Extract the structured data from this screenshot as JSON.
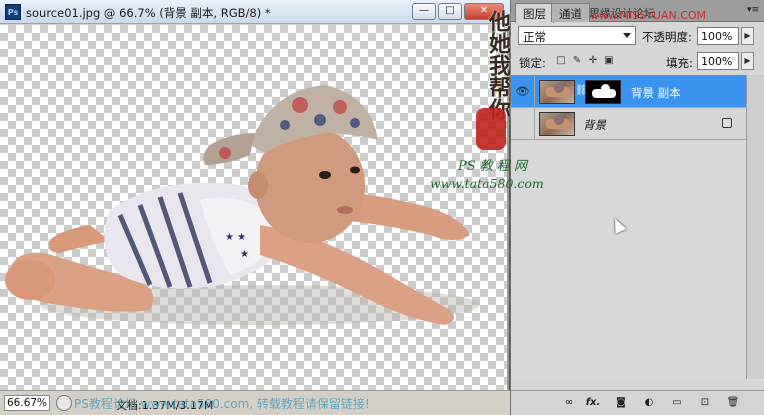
{
  "document": {
    "app_logo": "Ps",
    "title": "source01.jpg @ 66.7% (背景 副本, RGB/8) *",
    "window_buttons": {
      "minimize": "—",
      "maximize": "□",
      "close": "✕"
    },
    "zoom": "66.67%",
    "doc_info": "文档:1.37M/3.17M"
  },
  "panel": {
    "tabs": [
      {
        "label": "图层",
        "active": true
      },
      {
        "label": "通道",
        "active": false
      }
    ],
    "tab_overflow_text": "思缘设计论坛",
    "blend_mode": "正常",
    "opacity_label": "不透明度:",
    "opacity_value": "100%",
    "lock_label": "锁定:",
    "fill_label": "填充:",
    "fill_value": "100%",
    "layers": [
      {
        "name": "背景 副本",
        "selected": true,
        "visible": true,
        "has_mask": true,
        "locked": false
      },
      {
        "name": "背景",
        "selected": false,
        "visible": false,
        "has_mask": false,
        "locked": true
      }
    ],
    "bottom_icons": [
      "link-icon",
      "fx-icon",
      "mask-icon",
      "adjustment-icon",
      "group-icon",
      "new-layer-icon",
      "trash-icon"
    ],
    "bottom_labels": {
      "link": "∞",
      "fx": "fx.",
      "mask": "◙",
      "adjustment": "◐",
      "group": "▭",
      "new_layer": "⊡",
      "trash": "🗑"
    }
  },
  "watermarks": {
    "vertical": "他她我帮你",
    "seal": "",
    "ps_label": "PS 教 程 网",
    "url": "www.tata580.com",
    "top": "www.MISSYUAN.COM",
    "bottom": "PS教程论坛 www.tata580.com, 转载教程请保留链接!"
  },
  "colors": {
    "selection": "#3a93ee",
    "panel_bg": "#d6d6d6",
    "titlebar": "#c9d9ec"
  }
}
